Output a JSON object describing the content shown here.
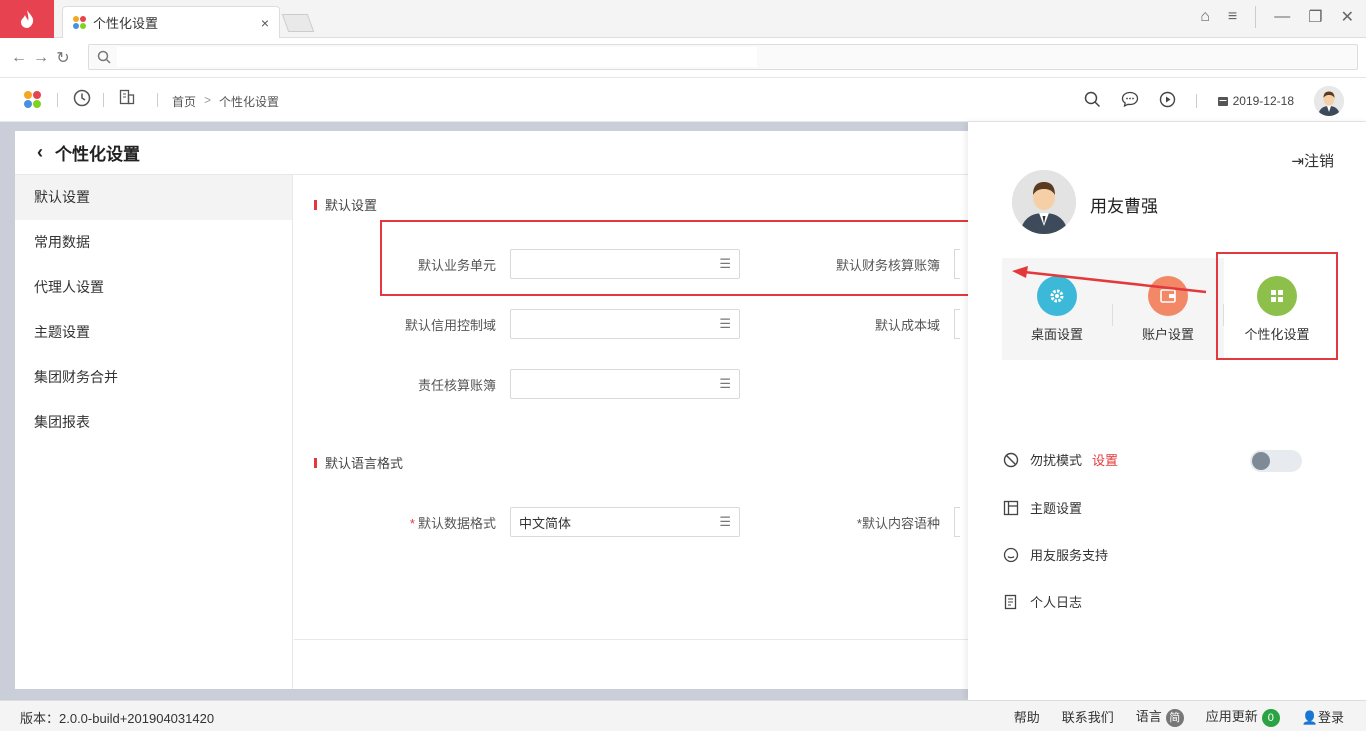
{
  "browser": {
    "tab_title": "个性化设置",
    "tab_close": "×",
    "url_placeholder": ""
  },
  "header": {
    "breadcrumb": [
      "首页",
      "个性化设置"
    ],
    "breadcrumb_sep": ">",
    "date": "2019-12-18"
  },
  "page": {
    "title": "个性化设置",
    "back_glyph": "‹"
  },
  "sidebar": {
    "items": [
      {
        "label": "默认设置",
        "active": true
      },
      {
        "label": "常用数据"
      },
      {
        "label": "代理人设置"
      },
      {
        "label": "主题设置"
      },
      {
        "label": "集团财务合并"
      },
      {
        "label": "集团报表"
      }
    ]
  },
  "section1": {
    "title": "默认设置",
    "fields": [
      {
        "label": "默认业务单元",
        "value": ""
      },
      {
        "label": "默认财务核算账簿",
        "value": ""
      },
      {
        "label": "默认信用控制域",
        "value": ""
      },
      {
        "label": "默认成本域",
        "value": ""
      },
      {
        "label": "责任核算账簿",
        "value": ""
      }
    ]
  },
  "section2": {
    "title": "默认语言格式",
    "required_mark": "*",
    "fields": [
      {
        "label": "默认数据格式",
        "value": "中文简体"
      },
      {
        "label": "默认内容语种",
        "value": ""
      }
    ]
  },
  "panel": {
    "logout": "注销",
    "user_name": "用友曹强",
    "quick": [
      {
        "label": "桌面设置",
        "color": "#3cb9d8",
        "icon": "gear-icon"
      },
      {
        "label": "账户设置",
        "color": "#f28866",
        "icon": "wallet-icon"
      },
      {
        "label": "个性化设置",
        "color": "#8cc04b",
        "icon": "grid-icon"
      }
    ],
    "dnd_label": "勿扰模式",
    "dnd_setting": "设置",
    "items": [
      "主题设置",
      "用友服务支持",
      "个人日志"
    ]
  },
  "status": {
    "version": "版本：2.0.0-build+201904031420",
    "help": "帮助",
    "contact": "联系我们",
    "language": "语言",
    "language_badge": "简",
    "update": "应用更新",
    "update_count": "0",
    "login": "登录"
  },
  "colors": {
    "accent_red": "#e4393c",
    "app_red": "#e64250"
  }
}
